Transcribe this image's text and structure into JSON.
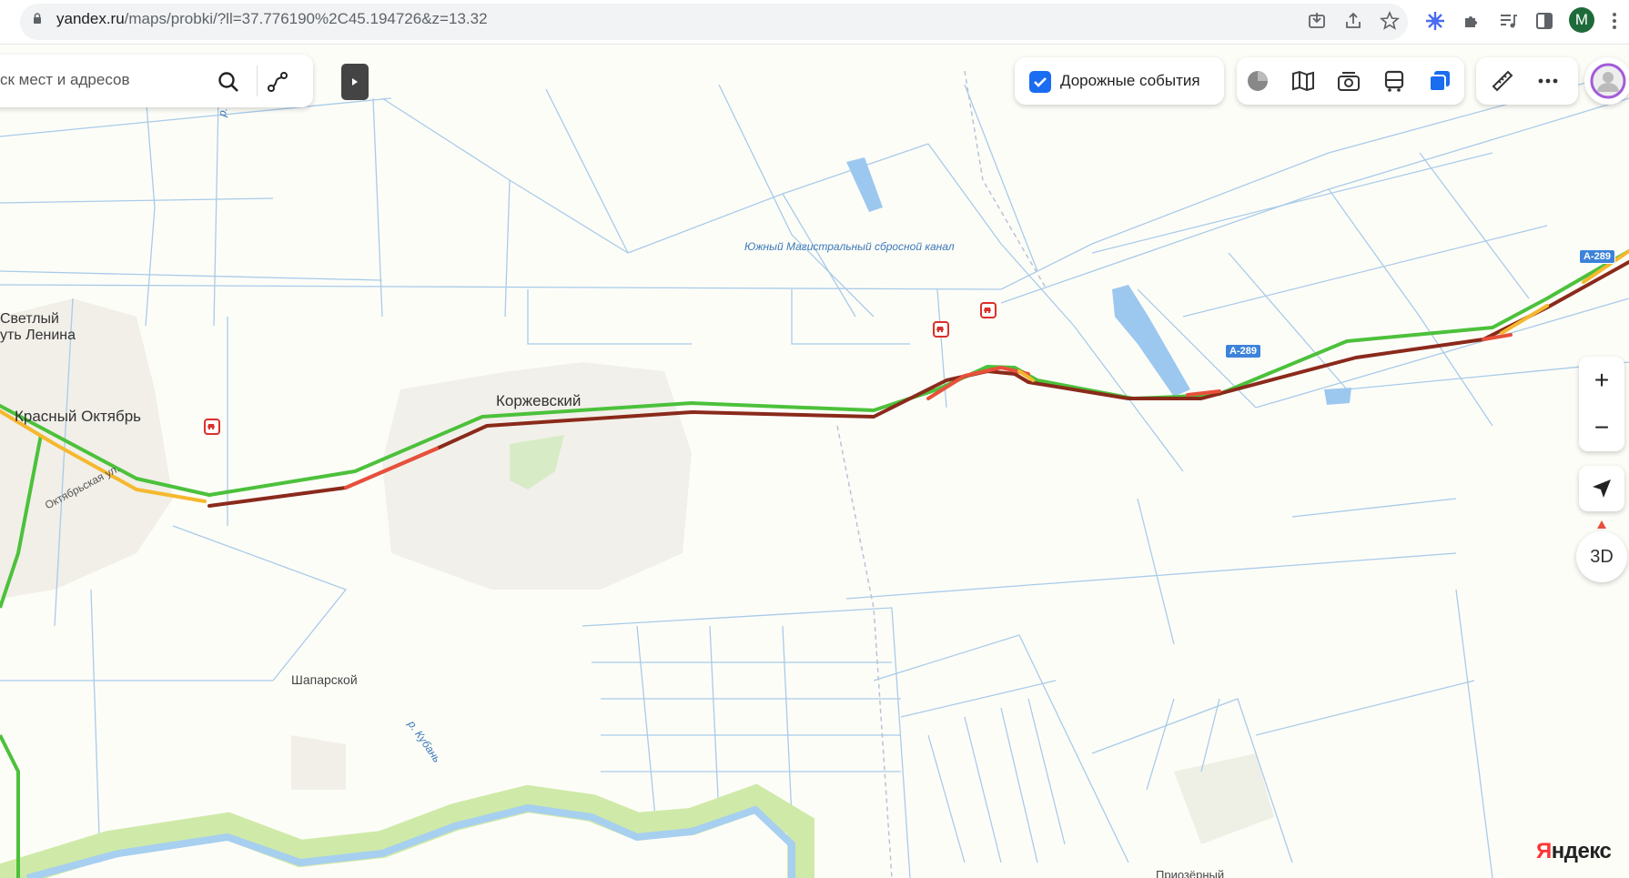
{
  "browser": {
    "url_host": "yandex.ru",
    "url_path": "/maps/probki/?ll=37.776190%2C45.194726&z=13.32",
    "profile_initial": "M"
  },
  "search": {
    "placeholder_visible": "ск мест и адресов"
  },
  "toolbar": {
    "road_events_label": "Дорожные события",
    "road_events_checked": true,
    "layer_icons": [
      "traffic-layer-icon",
      "map-layers-icon",
      "camera-icon",
      "transport-icon",
      "layers-icon"
    ],
    "tool_icons": [
      "ruler-icon",
      "more-icon"
    ]
  },
  "controls": {
    "zoom_in": "+",
    "zoom_out": "−",
    "three_d": "3D"
  },
  "map": {
    "places": {
      "svetly_1": "Светлый",
      "svetly_2": "уть Ленина",
      "krasny_oktyabr": "Красный Октябрь",
      "korzhevsky": "Коржевский",
      "shaparskoy": "Шапарской",
      "oktyabrskaya": "Октябрьская ул.",
      "bottom_partial": "Приозёрный"
    },
    "water": {
      "canal": "Южный Магистральный сбросной канал",
      "river_kuban": "р. Кубань",
      "river_ku": "р. Ку"
    },
    "road_shields": [
      "А-289",
      "А-289"
    ],
    "traffic_colors": {
      "free": "#4cc13b",
      "moderate": "#f5b82e",
      "heavy": "#e8503b",
      "jam": "#8a2a1b"
    }
  },
  "logo": {
    "first": "Я",
    "rest": "ндекс"
  }
}
